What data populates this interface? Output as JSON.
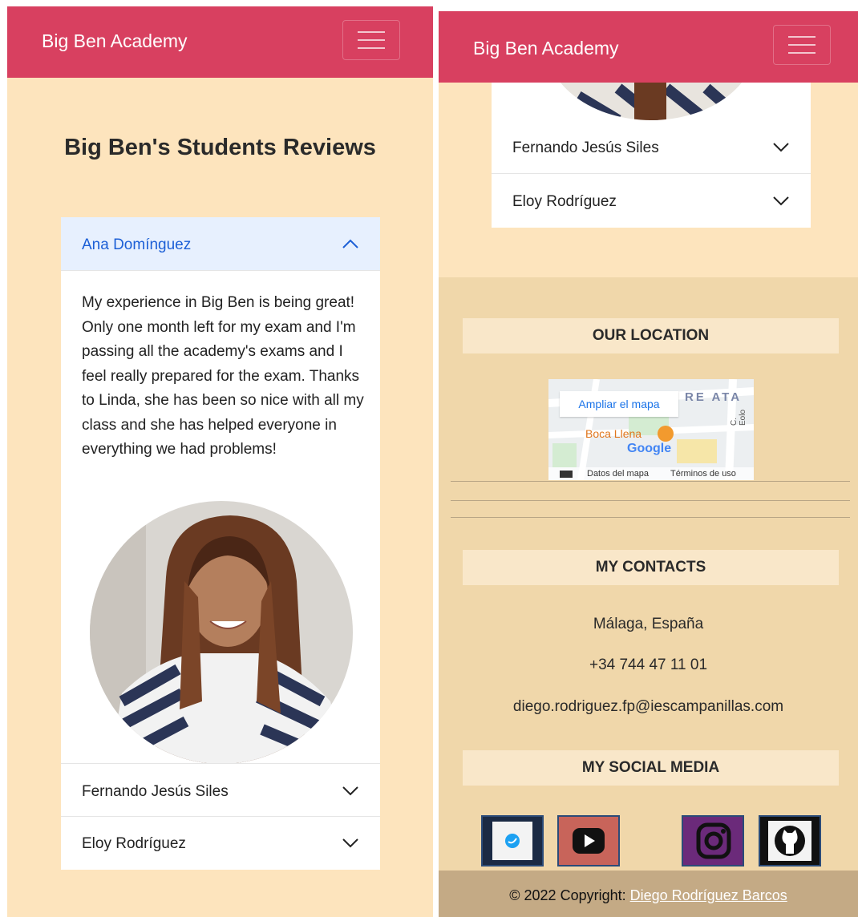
{
  "brand": "Big Ben Academy",
  "page_title": "Big Ben's Students Reviews",
  "reviews": [
    {
      "name": "Ana Domínguez",
      "expanded": true,
      "text": "My experience in Big Ben is being great! Only one month left for my exam and I'm passing all the academy's exams and I feel really prepared for the exam. Thanks to Linda, she has been so nice with all my class and she has helped everyone in everything we had problems!"
    },
    {
      "name": "Fernando Jesús Siles",
      "expanded": false
    },
    {
      "name": "Eloy Rodríguez",
      "expanded": false
    }
  ],
  "location": {
    "heading": "OUR LOCATION",
    "map_button": "Ampliar el mapa",
    "map_place": "Boca Llena",
    "map_logo": "Google",
    "map_street_label": "RE ATA",
    "map_side_street": "C. Eolo",
    "map_data_label": "Datos del mapa",
    "map_terms_label": "Términos de uso"
  },
  "contacts": {
    "heading": "MY CONTACTS",
    "city": "Málaga, España",
    "phone": "+34 744 47 11 01",
    "email": "diego.rodriguez.fp@iescampanillas.com"
  },
  "social": {
    "heading": "MY SOCIAL MEDIA",
    "items": [
      {
        "icon": "twitter-icon",
        "color": "#1da1f2"
      },
      {
        "icon": "youtube-icon",
        "color": "#c8645a"
      },
      {
        "icon": "instagram-icon",
        "color": "#6b2a7a"
      },
      {
        "icon": "github-icon",
        "color": "#111111"
      }
    ]
  },
  "footer": {
    "copyright_prefix": "© 2022 Copyright: ",
    "author_link": "Diego Rodríguez Barcos"
  },
  "colors": {
    "navbar": "#d84060",
    "page_background": "#fde4bd",
    "footer_background": "#f0d7aa",
    "copyright_background": "#c4aa85",
    "accordion_active_text": "#1c5fd6"
  }
}
